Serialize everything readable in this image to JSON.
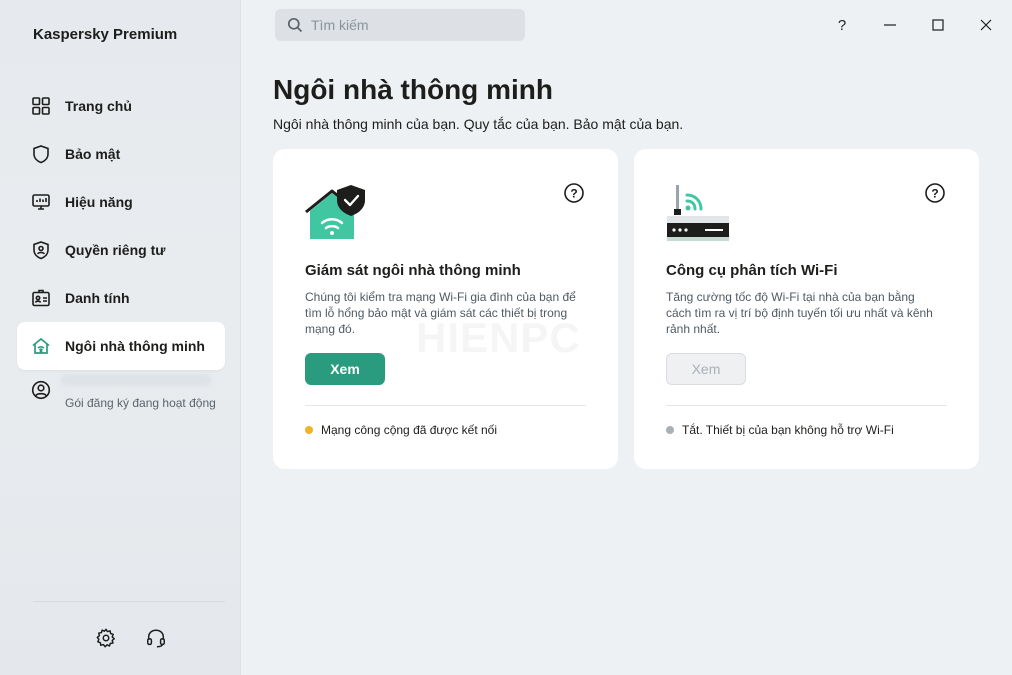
{
  "app": {
    "name": "Kaspersky Premium"
  },
  "sidebar": {
    "items": [
      {
        "label": "Trang chủ",
        "icon": "dashboard-icon"
      },
      {
        "label": "Bảo mật",
        "icon": "shield-icon"
      },
      {
        "label": "Hiệu năng",
        "icon": "performance-monitor-icon"
      },
      {
        "label": "Quyền riêng tư",
        "icon": "privacy-shield-icon"
      },
      {
        "label": "Danh tính",
        "icon": "id-card-icon"
      },
      {
        "label": "Ngôi nhà thông minh",
        "icon": "smart-home-icon",
        "active": true
      }
    ],
    "account": {
      "subtitle": "Gói đăng ký đang hoạt động"
    }
  },
  "search": {
    "placeholder": "Tìm kiếm"
  },
  "main": {
    "title": "Ngôi nhà thông minh",
    "subtitle": "Ngôi nhà thông minh của bạn. Quy tắc của bạn. Bảo mật của bạn.",
    "cards": [
      {
        "title": "Giám sát ngôi nhà thông minh",
        "description": "Chúng tôi kiểm tra mạng Wi-Fi gia đình của bạn để tìm lỗ hổng bảo mật và giám sát các thiết bị trong mạng đó.",
        "button": "Xem",
        "status": "Mạng công cộng đã được kết nối",
        "status_color": "#f0b429"
      },
      {
        "title": "Công cụ phân tích Wi-Fi",
        "description": "Tăng cường tốc độ Wi-Fi tại nhà của bạn bằng cách tìm ra vị trí bộ định tuyến tối ưu nhất và kênh rảnh nhất.",
        "button": "Xem",
        "status": "Tắt. Thiết bị của bạn không hỗ trợ Wi-Fi",
        "status_color": "#a9b0b6"
      }
    ]
  },
  "watermark": "HIENPC",
  "colors": {
    "accent": "#2b9b80",
    "background": "#eef1f4",
    "card": "#ffffff"
  }
}
